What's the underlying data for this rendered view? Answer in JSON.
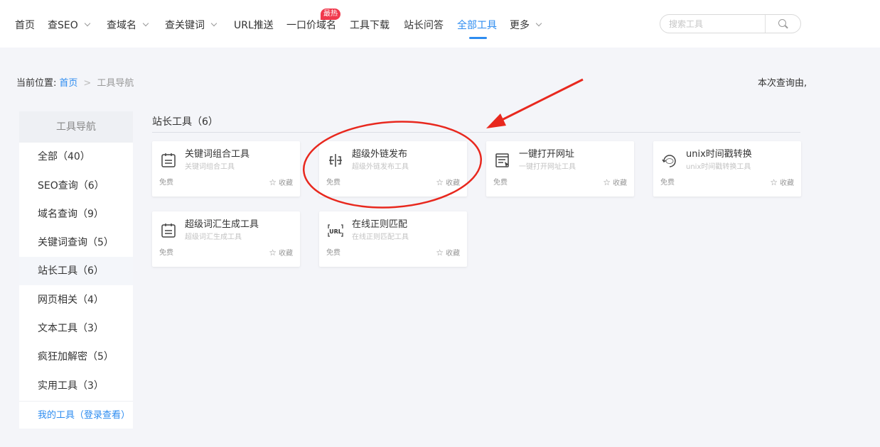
{
  "nav": {
    "items": [
      {
        "label": "首页",
        "dropdown": false
      },
      {
        "label": "查SEO",
        "dropdown": true
      },
      {
        "label": "查域名",
        "dropdown": true
      },
      {
        "label": "查关键词",
        "dropdown": true
      },
      {
        "label": "URL推送",
        "dropdown": false
      },
      {
        "label": "一口价域名",
        "dropdown": false
      },
      {
        "label": "工具下载",
        "dropdown": false
      },
      {
        "label": "站长问答",
        "dropdown": false
      },
      {
        "label": "全部工具",
        "dropdown": false,
        "active": true
      },
      {
        "label": "更多",
        "dropdown": true
      }
    ],
    "hot_badge": "最热",
    "search_placeholder": "搜索工具",
    "accent_color": "#2d8cf0"
  },
  "breadcrumb": {
    "label": "当前位置:",
    "home": "首页",
    "separator": ">",
    "current": "工具导航"
  },
  "query_info": "本次查询由,",
  "sidebar": {
    "header": "工具导航",
    "items": [
      {
        "label": "全部（40）"
      },
      {
        "label": "SEO查询（6）"
      },
      {
        "label": "域名查询（9）"
      },
      {
        "label": "关键词查询（5）"
      },
      {
        "label": "站长工具（6）",
        "active": true
      },
      {
        "label": "网页相关（4）"
      },
      {
        "label": "文本工具（3）"
      },
      {
        "label": "疯狂加解密（5）"
      },
      {
        "label": "实用工具（3）"
      }
    ],
    "my_tools": "我的工具（登录查看）"
  },
  "section": {
    "title": "站长工具（6）"
  },
  "tools": [
    {
      "title": "关键词组合工具",
      "desc": "关键词组合工具",
      "price": "免费",
      "fav": "收藏",
      "icon": "calendar-icon"
    },
    {
      "title": "超级外链发布",
      "desc": "超级外链发布工具",
      "price": "免费",
      "fav": "收藏",
      "icon": "link-publish-icon"
    },
    {
      "title": "一键打开网址",
      "desc": "一键打开网址工具",
      "price": "免费",
      "fav": "收藏",
      "icon": "browser-window-icon"
    },
    {
      "title": "unix时间戳转换",
      "desc": "unix时间戳转换工具",
      "price": "免费",
      "fav": "收藏",
      "icon": "unix-clock-icon"
    },
    {
      "title": "超级词汇生成工具",
      "desc": "超级词汇生成工具",
      "price": "免费",
      "fav": "收藏",
      "icon": "calendar-icon"
    },
    {
      "title": "在线正则匹配",
      "desc": "在线正则匹配工具",
      "price": "免费",
      "fav": "收藏",
      "icon": "url-icon"
    }
  ],
  "annotation_color": "#e8281e"
}
